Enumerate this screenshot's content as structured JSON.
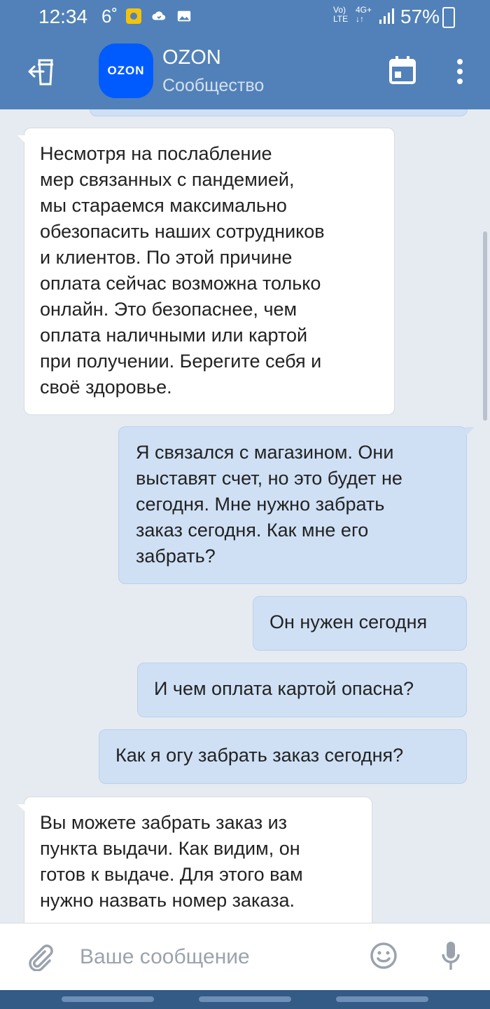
{
  "status_bar": {
    "time": "12:34",
    "temperature": "6˚",
    "network_top": "Vo)",
    "network_bottom": "LTE",
    "network2_top": "4G+",
    "battery": "57%"
  },
  "header": {
    "avatar_text": "OZON",
    "title": "OZON",
    "subtitle": "Сообщество",
    "icons": [
      "back-icon",
      "calendar-icon",
      "more-vertical-icon"
    ],
    "bar_color": "#5181b8"
  },
  "messages": [
    {
      "direction": "incoming",
      "lines": [
        "Несмотря на послабление",
        "мер связанных с пандемией,",
        "мы стараемся максимально",
        "обезопасить наших сотрудников",
        "и клиентов. По этой причине",
        "оплата сейчас возможна только",
        "онлайн. Это безопаснее, чем",
        "оплата наличными или картой",
        "при получении. Берегите себя и",
        "своё здоровье."
      ]
    },
    {
      "direction": "outgoing",
      "lines": [
        "Я связался с магазином. Они",
        "выставят счет, но это будет не",
        "сегодня. Мне нужно забрать",
        "заказ сегодня. Как мне его",
        "забрать?"
      ]
    },
    {
      "direction": "outgoing",
      "lines": [
        "Он нужен сегодня"
      ]
    },
    {
      "direction": "outgoing",
      "lines": [
        "И чем оплата картой опасна?"
      ]
    },
    {
      "direction": "outgoing",
      "lines": [
        "Как я огу забрать заказ сегодня?"
      ]
    },
    {
      "direction": "incoming",
      "lines": [
        "Вы можете забрать заказ из",
        "пункта выдачи. Как видим, он",
        "готов к выдаче. Для этого вам",
        "нужно назвать номер заказа."
      ]
    }
  ],
  "composer": {
    "placeholder": "Ваше сообщение",
    "icons": [
      "attach-icon",
      "smile-icon",
      "mic-icon"
    ]
  },
  "colors": {
    "incoming_bubble": "#ffffff",
    "outgoing_bubble": "#cfe0f5",
    "background": "#e6ebf1",
    "ozon_blue": "#005bff"
  }
}
